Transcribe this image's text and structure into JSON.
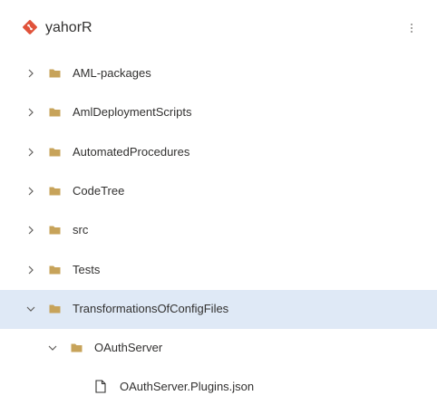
{
  "header": {
    "repo_name": "yahorR",
    "repo_icon": "git-repo-icon",
    "more_icon": "more-vertical-icon",
    "accent_color": "#e0523a"
  },
  "tree": {
    "folder_color": "#c7a35a",
    "selected_color": "#dfe9f6",
    "items": [
      {
        "label": "AML-packages",
        "type": "folder",
        "expanded": false,
        "depth": 0
      },
      {
        "label": "AmlDeploymentScripts",
        "type": "folder",
        "expanded": false,
        "depth": 0
      },
      {
        "label": "AutomatedProcedures",
        "type": "folder",
        "expanded": false,
        "depth": 0
      },
      {
        "label": "CodeTree",
        "type": "folder",
        "expanded": false,
        "depth": 0
      },
      {
        "label": "src",
        "type": "folder",
        "expanded": false,
        "depth": 0
      },
      {
        "label": "Tests",
        "type": "folder",
        "expanded": false,
        "depth": 0
      },
      {
        "label": "TransformationsOfConfigFiles",
        "type": "folder",
        "expanded": true,
        "depth": 0,
        "selected": true
      },
      {
        "label": "OAuthServer",
        "type": "folder",
        "expanded": true,
        "depth": 1
      },
      {
        "label": "OAuthServer.Plugins.json",
        "type": "file",
        "depth": 2
      }
    ]
  }
}
